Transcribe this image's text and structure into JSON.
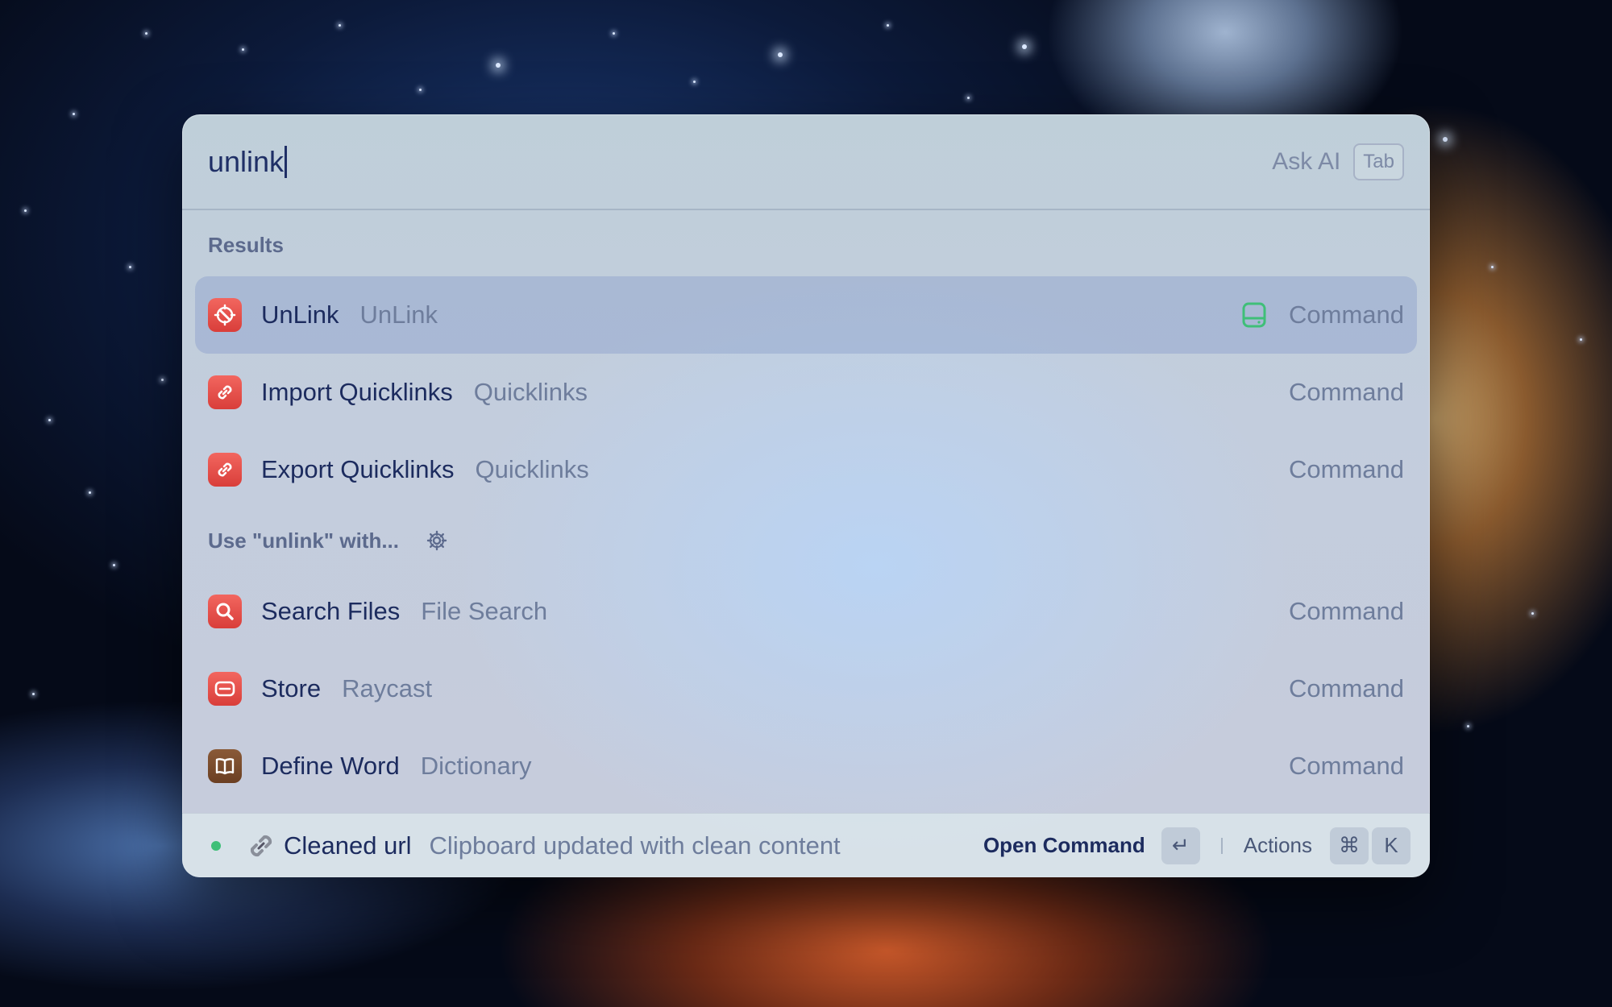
{
  "search": {
    "query": "unlink",
    "ask_ai_label": "Ask AI",
    "ask_ai_key": "Tab"
  },
  "results_section": {
    "label": "Results"
  },
  "results": [
    {
      "title": "UnLink",
      "subtitle": "UnLink",
      "type": "Command",
      "icon": "unlink-app-icon",
      "selected": true
    },
    {
      "title": "Import Quicklinks",
      "subtitle": "Quicklinks",
      "type": "Command",
      "icon": "quicklink-icon"
    },
    {
      "title": "Export Quicklinks",
      "subtitle": "Quicklinks",
      "type": "Command",
      "icon": "quicklink-icon"
    }
  ],
  "fallback_section": {
    "label": "Use \"unlink\" with..."
  },
  "fallbacks": [
    {
      "title": "Search Files",
      "subtitle": "File Search",
      "type": "Command",
      "icon": "search-icon"
    },
    {
      "title": "Store",
      "subtitle": "Raycast",
      "type": "Command",
      "icon": "store-icon"
    },
    {
      "title": "Define Word",
      "subtitle": "Dictionary",
      "type": "Command",
      "icon": "book-icon"
    }
  ],
  "footer": {
    "toast_title": "Cleaned url",
    "toast_message": "Clipboard updated with clean content",
    "primary_action": "Open Command",
    "primary_key": "↵",
    "actions_label": "Actions",
    "actions_keys": [
      "⌘",
      "K"
    ]
  },
  "colors": {
    "accent_red": "#e0473f",
    "status_green": "#3fbf78",
    "text_primary": "#1c2b5e",
    "text_secondary": "#6e7d9c"
  }
}
